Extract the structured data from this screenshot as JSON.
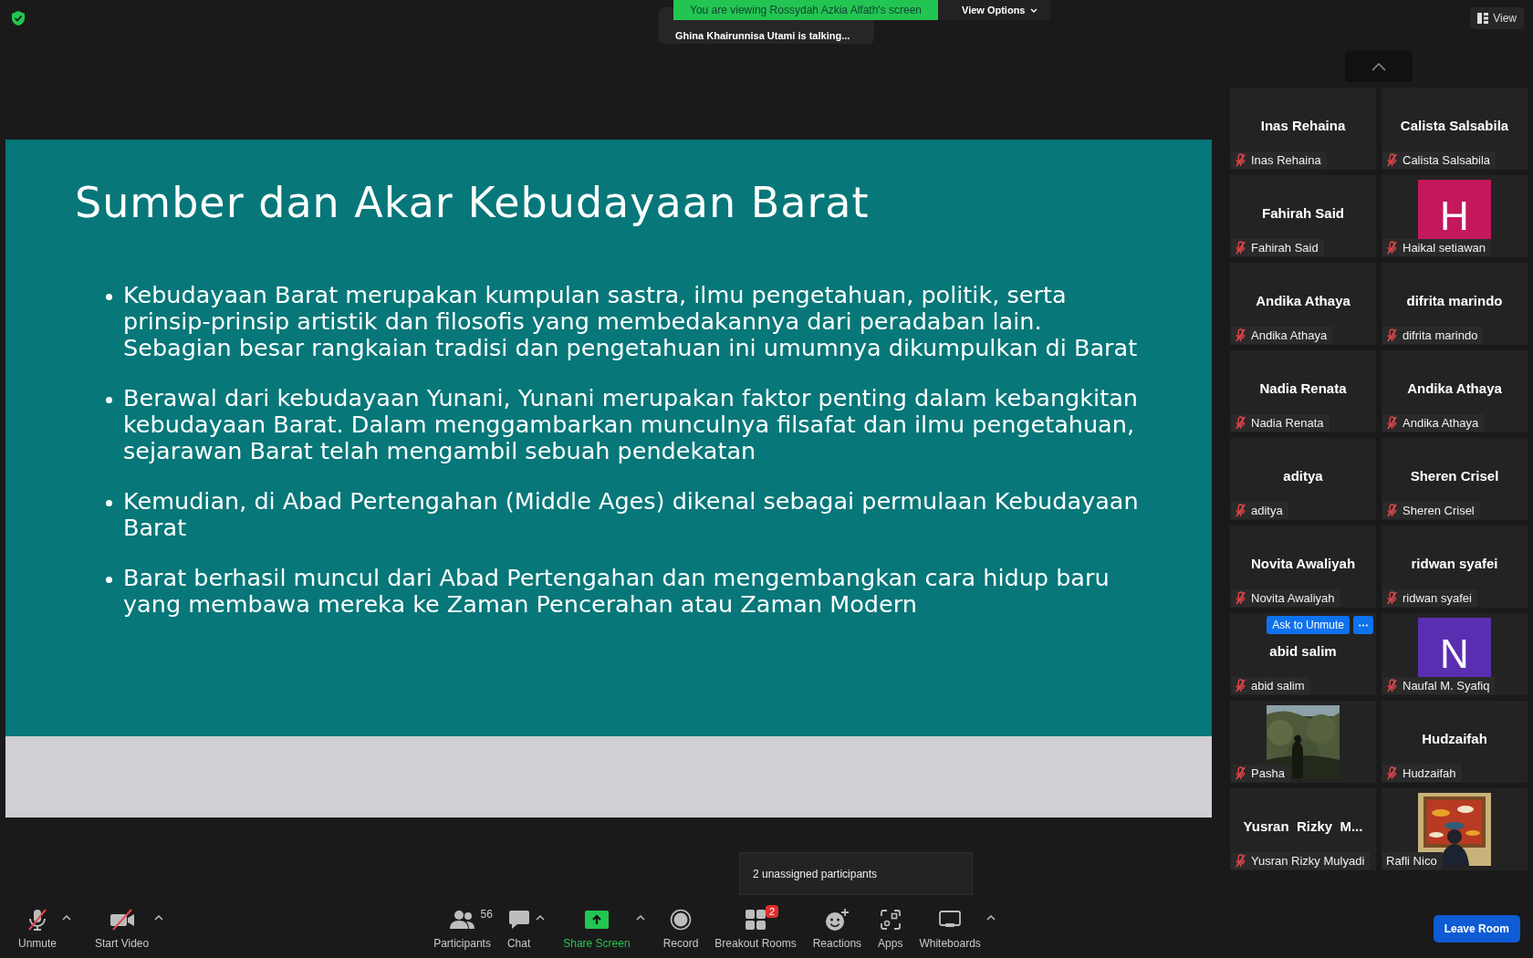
{
  "share_banner": {
    "text": "You are viewing Rossydah Azkia Alfath's screen",
    "view_options": "View Options"
  },
  "talking_indicator": "Ghina Khairunnisa Utami is talking...",
  "view_button": "View",
  "slide": {
    "title": "Sumber dan Akar Kebudayaan Barat",
    "bullets": [
      "Kebudayaan Barat merupakan kumpulan sastra, ilmu pengetahuan, politik, serta prinsip-prinsip artistik dan filosofis yang membedakannya dari peradaban lain. Sebagian besar rangkaian tradisi dan pengetahuan ini umumnya dikumpulkan di Barat",
      "Berawal dari kebudayaan Yunani, Yunani merupakan faktor penting dalam kebangkitan kebudayaan Barat. Dalam menggambarkan munculnya filsafat dan ilmu pengetahuan, sejarawan Barat telah mengambil sebuah pendekatan",
      "Kemudian, di Abad Pertengahan (Middle Ages) dikenal sebagai permulaan Kebudayaan Barat",
      "Barat berhasil muncul dari Abad Pertengahan dan mengembangkan cara hidup baru yang membawa mereka ke Zaman Pencerahan atau Zaman Modern"
    ]
  },
  "participants": [
    {
      "kind": "name",
      "display": "Inas Rehaina",
      "label": "Inas Rehaina",
      "muted": true
    },
    {
      "kind": "name",
      "display": "Calista Salsabila",
      "label": "Calista Salsabila",
      "muted": true
    },
    {
      "kind": "name",
      "display": "Fahirah Said",
      "label": "Fahirah Said",
      "muted": true
    },
    {
      "kind": "avatar",
      "letter": "H",
      "color": "#c4185c",
      "label": "Haikal setiawan",
      "muted": true
    },
    {
      "kind": "name",
      "display": "Andika Athaya",
      "label": "Andika Athaya",
      "muted": true
    },
    {
      "kind": "name",
      "display": "difrita marindo",
      "label": "difrita marindo",
      "muted": true
    },
    {
      "kind": "name",
      "display": "Nadia Renata",
      "label": "Nadia Renata",
      "muted": true
    },
    {
      "kind": "name",
      "display": "Andika Athaya",
      "label": "Andika Athaya",
      "muted": true
    },
    {
      "kind": "name",
      "display": "aditya",
      "label": "aditya",
      "muted": true
    },
    {
      "kind": "name",
      "display": "Sheren Crisel",
      "label": "Sheren Crisel",
      "muted": true
    },
    {
      "kind": "name",
      "display": "Novita Awaliyah",
      "label": "Novita Awaliyah",
      "muted": true
    },
    {
      "kind": "name",
      "display": "ridwan syafei",
      "label": "ridwan syafei",
      "muted": true
    },
    {
      "kind": "name",
      "display": "abid salim",
      "label": "abid salim",
      "muted": true,
      "ask_to_unmute": "Ask to Unmute"
    },
    {
      "kind": "avatar",
      "letter": "N",
      "color": "#5a2eb0",
      "label": "Naufal M. Syafiq",
      "muted": true
    },
    {
      "label": "Pasha",
      "muted": true
    },
    {
      "kind": "name",
      "display": "Hudzaifah",
      "label": "Hudzaifah",
      "muted": true
    },
    {
      "kind": "name",
      "display": "Yusran  Rizky  M...",
      "label": "Yusran Rizky Mulyadi",
      "muted": true
    },
    {
      "label": "Rafli Nico",
      "muted": false
    }
  ],
  "tooltip": "2 unassigned participants",
  "toolbar": {
    "left": [
      {
        "kind": "mic",
        "label": "Unmute",
        "caret": true
      },
      {
        "kind": "video",
        "label": "Start Video",
        "caret": true
      }
    ],
    "center": [
      {
        "kind": "participants",
        "label": "Participants",
        "count": "56",
        "caret": false
      },
      {
        "kind": "chat",
        "label": "Chat",
        "caret": true
      },
      {
        "kind": "share",
        "label": "Share Screen",
        "caret": true
      },
      {
        "kind": "record",
        "label": "Record",
        "caret": false
      },
      {
        "kind": "breakout",
        "label": "Breakout Rooms",
        "badge": "2",
        "caret": false
      },
      {
        "kind": "reactions",
        "label": "Reactions",
        "caret": false
      },
      {
        "kind": "apps",
        "label": "Apps",
        "caret": false
      },
      {
        "kind": "whiteboards",
        "label": "Whiteboards",
        "caret": true
      }
    ],
    "leave": "Leave Room"
  }
}
